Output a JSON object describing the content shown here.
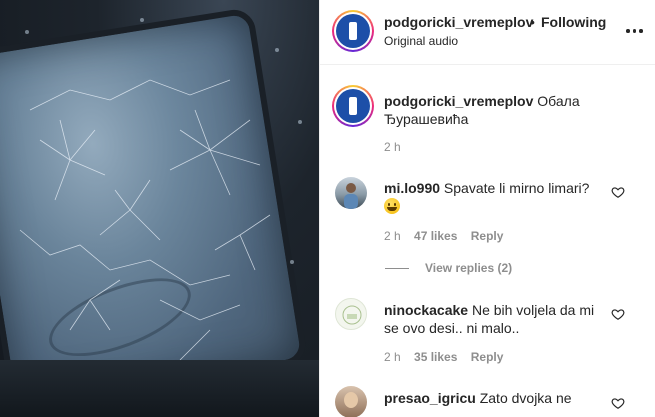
{
  "post": {
    "username": "podgoricki_vremeplov",
    "separator": "•",
    "follow_status": "Following",
    "audio": "Original audio",
    "caption_user": "podgoricki_vremeplov",
    "caption_text": "Обала Ђурашевића",
    "caption_time": "2 h"
  },
  "comments": [
    {
      "user": "mi.lo990",
      "text": "Spavate li mirno limari?",
      "emoji": "grinning-face",
      "time": "2 h",
      "likes": "47 likes",
      "reply_label": "Reply",
      "view_replies": "View replies (2)"
    },
    {
      "user": "ninockacake",
      "text": "Ne bih voljela da mi se ovo desi.. ni malo..",
      "time": "2 h",
      "likes": "35 likes",
      "reply_label": "Reply"
    },
    {
      "user": "presao_igricu",
      "text": "Zato dvojka ne"
    }
  ],
  "colors": {
    "brand_logo": "#1d4fa8",
    "meta_text": "#8e8e8e",
    "divider": "#efefef"
  },
  "icons": {
    "more": "more-options-icon",
    "like": "heart-icon"
  }
}
